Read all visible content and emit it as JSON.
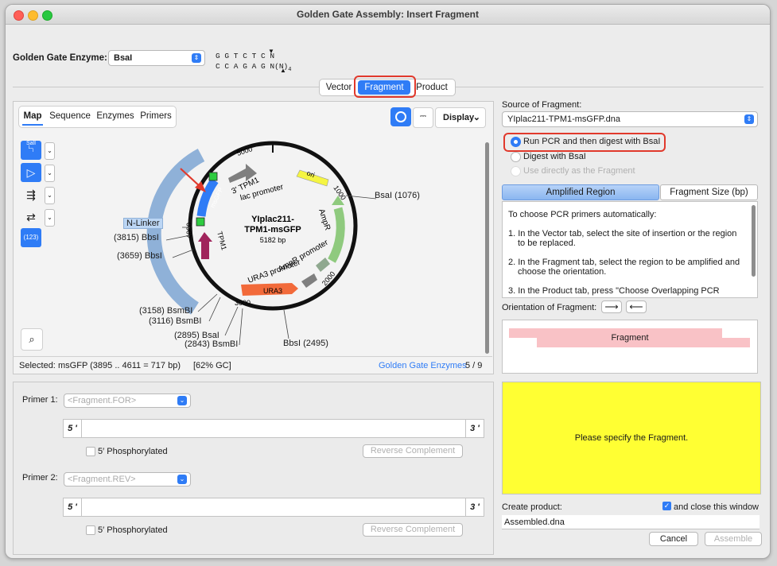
{
  "window": {
    "title": "Golden Gate Assembly: Insert Fragment"
  },
  "enzyme": {
    "label": "Golden Gate Enzyme:",
    "value": "BsaI",
    "site_top": "G G T C T C N",
    "site_bottom": "C C A G A G N",
    "site_suffix": "(N)",
    "site_sub": "4"
  },
  "main_tabs": [
    "Vector",
    "Fragment",
    "Product"
  ],
  "view_tabs": [
    "Map",
    "Sequence",
    "Enzymes",
    "Primers"
  ],
  "display_button": "Display",
  "tool_labels": {
    "sali": "SalI",
    "num": "(123)"
  },
  "map": {
    "name_line1": "YIplac211-",
    "name_line2": "TPM1-msGFP",
    "size": "5182 bp",
    "ticks": [
      "1000",
      "2000",
      "3000",
      "4000",
      "5000"
    ],
    "features": [
      "ori",
      "AmpR",
      "AmpR promoter",
      "URA3 promoter",
      "URA3",
      "TPM1",
      "msGFP",
      "3' TPM1",
      "lac promoter"
    ],
    "linker": "N-Linker",
    "sites": [
      "BsaI  (1076)",
      "(3815)  BbsI",
      "(3659)  BbsI",
      "(3158)  BsmBI",
      "(3116)  BsmBI",
      "(2895)  BsaI",
      "(2843)  BsmBI",
      "BbsI  (2495)"
    ]
  },
  "status": {
    "selected_label": "Selected:",
    "selected_value": "msGFP  (3895 .. 4611  =  717 bp)",
    "gc": "[62% GC]",
    "link": "Golden Gate Enzymes",
    "count": "5 / 9"
  },
  "primers": [
    {
      "label": "Primer 1:",
      "placeholder": "<Fragment.FOR>",
      "phos": "5′ Phosphorylated",
      "rc": "Reverse Complement",
      "end5": "5 '",
      "end3": "3 '"
    },
    {
      "label": "Primer 2:",
      "placeholder": "<Fragment.REV>",
      "phos": "5′ Phosphorylated",
      "rc": "Reverse Complement",
      "end5": "5 '",
      "end3": "3 '"
    }
  ],
  "source": {
    "label": "Source of Fragment:",
    "file": "YIplac211-TPM1-msGFP.dna",
    "options": [
      "Run PCR and then digest with BsaI",
      "Digest with BsaI",
      "Use directly as the Fragment"
    ]
  },
  "region_tabs": [
    "Amplified Region",
    "Fragment Size (bp)"
  ],
  "instructions": [
    "To choose PCR primers automatically:",
    "1. In the Vector tab, select the site of insertion or the region",
    "to be replaced.",
    "2. In the Fragment tab, select the region to be amplified and",
    "choose the orientation.",
    "3. In the Product tab, press \"Choose Overlapping PCR"
  ],
  "orientation_label": "Orientation of Fragment:",
  "fragment_label": "Fragment",
  "placeholder_message": "Please specify the Fragment.",
  "create": {
    "label": "Create product:",
    "close_label": "and close this window",
    "filename": "Assembled.dna"
  },
  "buttons": {
    "cancel": "Cancel",
    "assemble": "Assemble"
  },
  "colors": {
    "accent": "#2f7cf6",
    "highlight": "#e1392c",
    "yellow": "#ffff33",
    "fragment": "#f9c2c6"
  }
}
